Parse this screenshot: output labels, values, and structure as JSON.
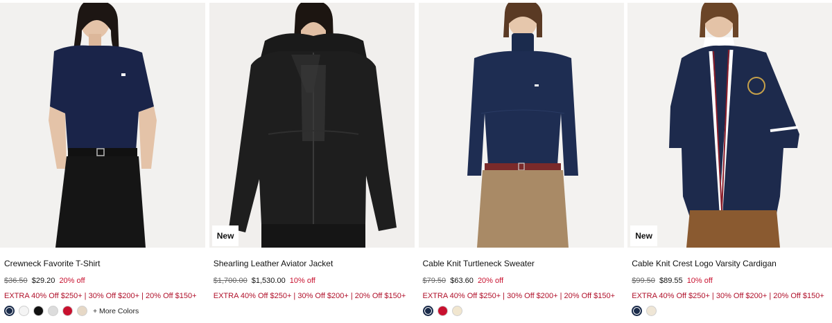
{
  "products": [
    {
      "name": "Crewneck Favorite T-Shirt",
      "original_price": "$36.50",
      "sale_price": "$29.20",
      "discount": "20% off",
      "promo": "EXTRA 40% Off $250+ | 30% Off $200+ | 20% Off $150+",
      "badge": "",
      "swatches": [
        "#1a2b4a",
        "#f4f4f4",
        "#111111",
        "#dcdcdc",
        "#c8102e",
        "#e6d8c6"
      ],
      "more_colors": "+ More Colors"
    },
    {
      "name": "Shearling Leather Aviator Jacket",
      "original_price": "$1,700.00",
      "sale_price": "$1,530.00",
      "discount": "10% off",
      "promo": "EXTRA 40% Off $250+ | 30% Off $200+ | 20% Off $150+",
      "badge": "New",
      "swatches": [],
      "more_colors": ""
    },
    {
      "name": "Cable Knit Turtleneck Sweater",
      "original_price": "$79.50",
      "sale_price": "$63.60",
      "discount": "20% off",
      "promo": "EXTRA 40% Off $250+ | 30% Off $200+ | 20% Off $150+",
      "badge": "",
      "swatches": [
        "#1a2b4a",
        "#c8102e",
        "#f1e6cf"
      ],
      "more_colors": ""
    },
    {
      "name": "Cable Knit Crest Logo Varsity Cardigan",
      "original_price": "$99.50",
      "sale_price": "$89.55",
      "discount": "10% off",
      "promo": "EXTRA 40% Off $250+ | 30% Off $200+ | 20% Off $150+",
      "badge": "New",
      "swatches": [
        "#1a2b4a",
        "#efe6d6"
      ],
      "more_colors": ""
    }
  ]
}
